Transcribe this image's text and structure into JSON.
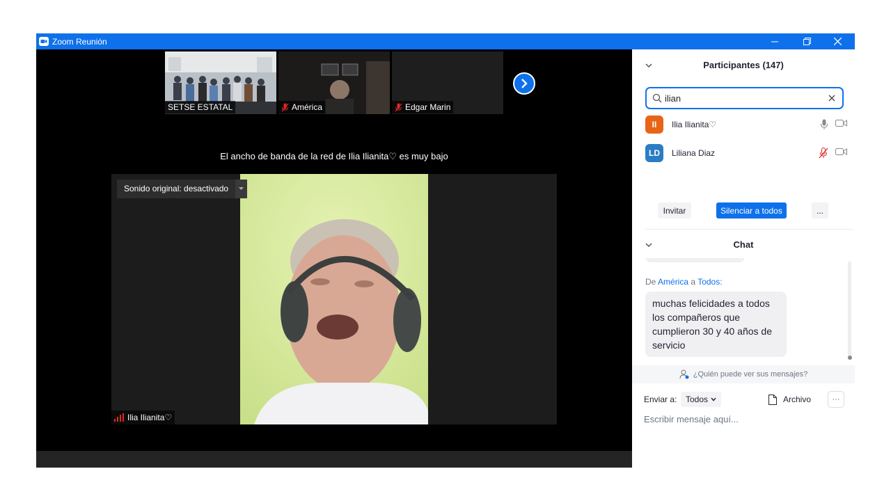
{
  "window": {
    "title": "Zoom Reunión"
  },
  "thumbnails": [
    {
      "name": "SETSE ESTATAL",
      "muted": false
    },
    {
      "name": "América",
      "muted": true
    },
    {
      "name": "Edgar Marin",
      "muted": true
    }
  ],
  "banner": "El ancho de banda de la red de Ilia Ilianita♡ es muy bajo",
  "main_video": {
    "audio_label": "Sonido original: desactivado",
    "speaker_name": "Ilia Ilianita♡"
  },
  "participants": {
    "header": "Participantes (147)",
    "search_value": "ilian",
    "list": [
      {
        "initials": "II",
        "name": "Ilia Ilianita♡",
        "color": "#e86518",
        "muted": false
      },
      {
        "initials": "LD",
        "name": "Liliana Diaz",
        "color": "#2a7dc4",
        "muted": true
      }
    ],
    "buttons": {
      "invite": "Invitar",
      "mute_all": "Silenciar a todos",
      "more": "..."
    }
  },
  "chat": {
    "header": "Chat",
    "message": {
      "prefix": "De",
      "sender": "América",
      "connector": "a",
      "recipient": "Todos:",
      "text": "muchas felicidades a todos los compañeros que cumplieron 30 y 40 años de servicio"
    },
    "who_can_see": "¿Quién puede ver sus mensajes?",
    "send_to_label": "Enviar a:",
    "send_to_value": "Todos",
    "file_label": "Archivo",
    "more": "···",
    "placeholder": "Escribir mensaje aquí..."
  },
  "colors": {
    "accent": "#0e71eb",
    "muted": "#e02828"
  }
}
